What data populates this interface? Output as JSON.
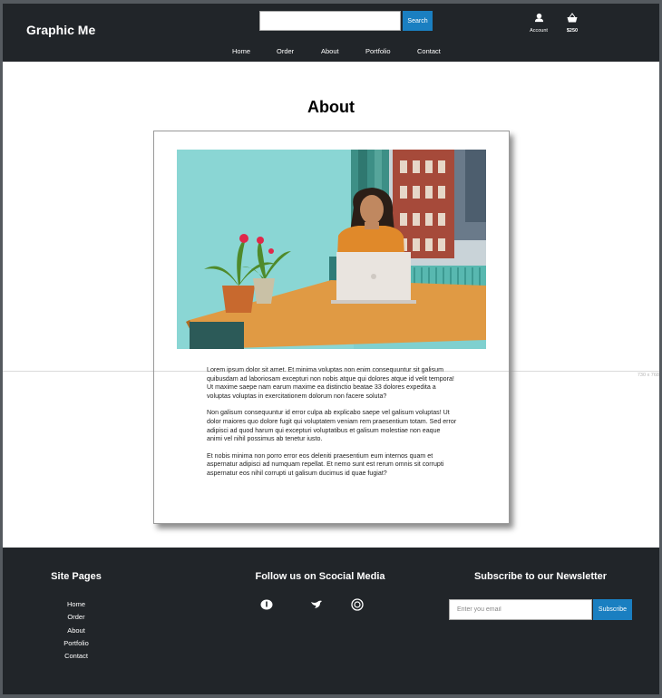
{
  "header": {
    "brand": "Graphic Me",
    "search": {
      "placeholder": "",
      "value": "",
      "button_label": "Search"
    },
    "account": {
      "label": "Account",
      "icon": "user-icon"
    },
    "cart": {
      "label": "$250",
      "icon": "basket-icon"
    },
    "nav": [
      "Home",
      "Order",
      "About",
      "Portfolio",
      "Contact"
    ]
  },
  "main": {
    "title": "About",
    "paragraphs": [
      "Lorem ipsum dolor sit amet. Et minima voluptas non enim consequuntur sit galisum quibusdam ad laboriosam excepturi non nobis atque qui dolores atque id velit tempora! Ut maxime saepe nam earum maxime ea distinctio beatae 33 dolores expedita a voluptas voluptas in exercitationem dolorum non facere soluta?",
      "Non galisum consequuntur id error culpa ab explicabo saepe vel galisum voluptas! Ut dolor maiores quo dolore fugit qui voluptatem veniam rem praesentium totam. Sed error adipisci ad quod harum qui excepturi voluptatibus et galisum molestiae non eaque animi vel nihil possimus ab tenetur iusto.",
      "Et nobis minima non porro error eos deleniti praesentium eum internos quam et aspernatur adipisci ad numquam repellat. Et nemo sunt est rerum omnis sit corrupti aspernatur eos nihil corrupti ut galisum ducimus id quae fugiat?"
    ],
    "guide_label": "730 x 768"
  },
  "footer": {
    "site_pages_title": "Site Pages",
    "site_pages": [
      "Home",
      "Order",
      "About",
      "Portfolio",
      "Contact"
    ],
    "social_title": "Follow us on Scocial Media",
    "social_icons": [
      "facebook-icon",
      "twitter-icon",
      "instagram-icon"
    ],
    "newsletter_title": "Subscribe to our Newsletter",
    "newsletter": {
      "placeholder": "Enter you email",
      "button_label": "Subscribe"
    }
  },
  "colors": {
    "header_bg": "#212529",
    "footer_bg": "#212529",
    "accent": "#1a7fc1",
    "page_bg": "#ffffff"
  }
}
